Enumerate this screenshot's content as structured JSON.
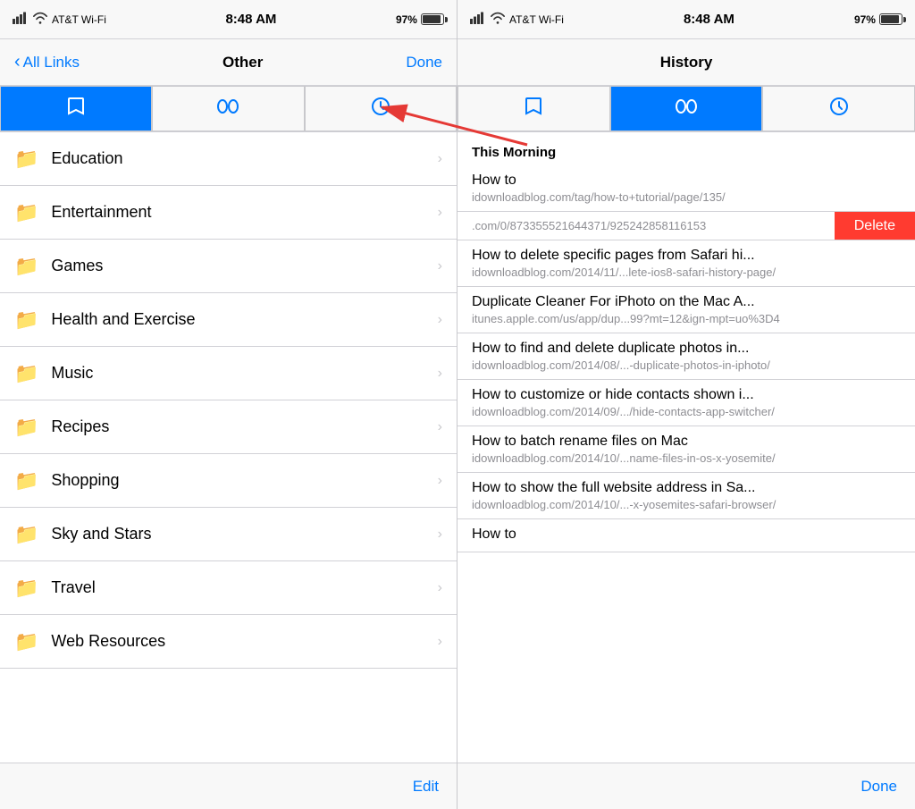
{
  "left": {
    "statusBar": {
      "carrier": "AT&T Wi-Fi",
      "time": "8:48 AM",
      "battery": "97%"
    },
    "navBar": {
      "back": "All Links",
      "title": "Other",
      "action": "Done"
    },
    "toolbar": {
      "tabs": [
        {
          "icon": "📖",
          "label": "bookmarks",
          "active": true
        },
        {
          "icon": "👓",
          "label": "reading-list",
          "active": false
        },
        {
          "icon": "🕐",
          "label": "history",
          "active": false
        }
      ]
    },
    "items": [
      {
        "label": "Education"
      },
      {
        "label": "Entertainment"
      },
      {
        "label": "Games"
      },
      {
        "label": "Health and Exercise"
      },
      {
        "label": "Music"
      },
      {
        "label": "Recipes"
      },
      {
        "label": "Shopping"
      },
      {
        "label": "Sky and Stars"
      },
      {
        "label": "Travel"
      },
      {
        "label": "Web Resources"
      }
    ],
    "bottomBar": {
      "action": "Edit"
    }
  },
  "right": {
    "statusBar": {
      "carrier": "AT&T Wi-Fi",
      "time": "8:48 AM",
      "battery": "97%"
    },
    "navBar": {
      "title": "History"
    },
    "toolbar": {
      "tabs": [
        {
          "icon": "📖",
          "label": "bookmarks",
          "active": false
        },
        {
          "icon": "👓",
          "label": "reading-list",
          "active": true
        },
        {
          "icon": "🕐",
          "label": "history",
          "active": false
        }
      ]
    },
    "sections": [
      {
        "header": "This Morning",
        "items": [
          {
            "title": "How to",
            "url": "idownloadblog.com/tag/how-to+tutorial/page/135/",
            "swiped": true,
            "swipedUrl": ".com/0/873355521644371/925242858116153"
          },
          {
            "title": "How to delete specific pages from Safari hi...",
            "url": "idownloadblog.com/2014/11/...lete-ios8-safari-history-page/"
          },
          {
            "title": "Duplicate Cleaner For iPhoto on the Mac A...",
            "url": "itunes.apple.com/us/app/dup...99?mt=12&ign-mpt=uo%3D4"
          },
          {
            "title": "How to find and delete duplicate photos in...",
            "url": "idownloadblog.com/2014/08/...-duplicate-photos-in-iphoto/"
          },
          {
            "title": "How to customize or hide contacts shown i...",
            "url": "idownloadblog.com/2014/09/.../hide-contacts-app-switcher/"
          },
          {
            "title": "How to batch rename files on Mac",
            "url": "idownloadblog.com/2014/10/...name-files-in-os-x-yosemite/"
          },
          {
            "title": "How to show the full website address in Sa...",
            "url": "idownloadblog.com/2014/10/...-x-yosemites-safari-browser/"
          },
          {
            "title": "How to",
            "url": ""
          }
        ]
      }
    ],
    "bottomBar": {
      "action": "Done"
    },
    "deleteLabel": "Delete"
  },
  "arrow": {
    "fromTab": "left-history-tab",
    "toSection": "this-morning"
  }
}
